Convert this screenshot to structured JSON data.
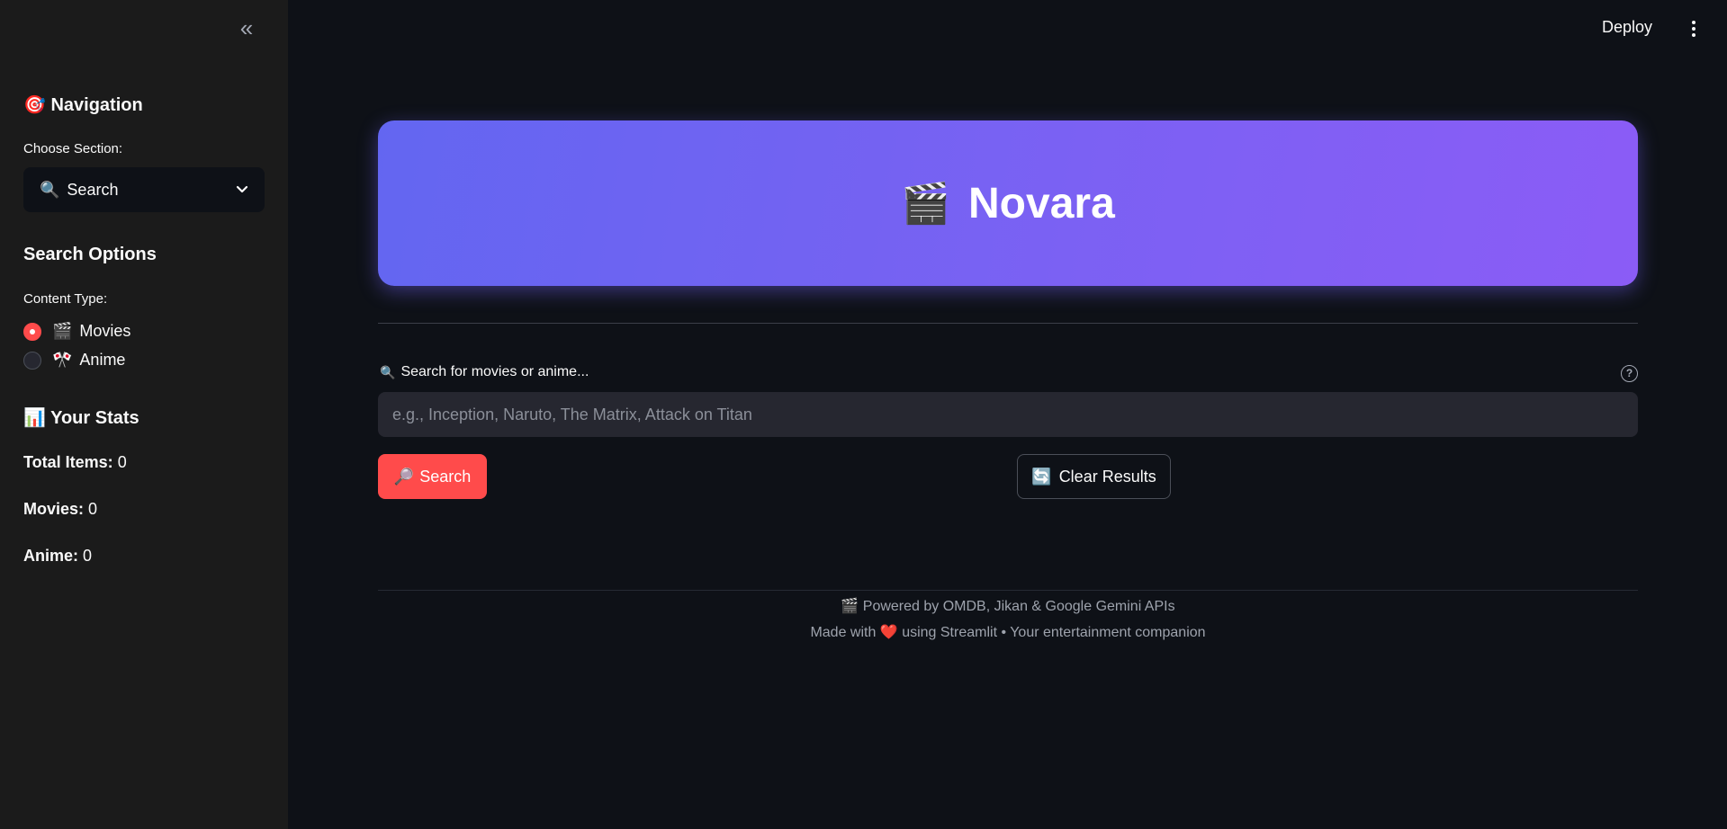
{
  "sidebar": {
    "collapse_glyph": "«",
    "navigation_title": "🎯 Navigation",
    "choose_section_label": "Choose Section:",
    "section_select": {
      "icon": "🔍",
      "value": "Search"
    },
    "search_options_title": "Search Options",
    "content_type_label": "Content Type:",
    "content_types": [
      {
        "icon": "🎬",
        "label": "Movies",
        "selected": true
      },
      {
        "icon": "🎌",
        "label": "Anime",
        "selected": false
      }
    ],
    "stats_title": "📊 Your Stats",
    "stats": [
      {
        "label": "Total Items:",
        "value": "0"
      },
      {
        "label": "Movies:",
        "value": "0"
      },
      {
        "label": "Anime:",
        "value": "0"
      }
    ]
  },
  "header": {
    "deploy_label": "Deploy"
  },
  "hero": {
    "icon": "🎬",
    "title": "Novara",
    "gradient_start": "#6366f1",
    "gradient_end": "#8b5cf6"
  },
  "search": {
    "label_icon": "🔍",
    "label": "Search for movies or anime...",
    "placeholder": "e.g., Inception, Naruto, The Matrix, Attack on Titan",
    "value": "",
    "search_button_icon": "🔎",
    "search_button_label": "Search",
    "clear_button_icon": "🔄",
    "clear_button_label": "Clear Results"
  },
  "footer": {
    "line1_icon": "🎬",
    "line1": "Powered by OMDB, Jikan & Google Gemini APIs",
    "line2_prefix": "Made with",
    "line2_heart": "❤️",
    "line2_suffix": "using Streamlit • Your entertainment companion"
  },
  "colors": {
    "accent": "#ff4b4b",
    "background": "#0e1117",
    "sidebar": "#1b1b1b"
  }
}
